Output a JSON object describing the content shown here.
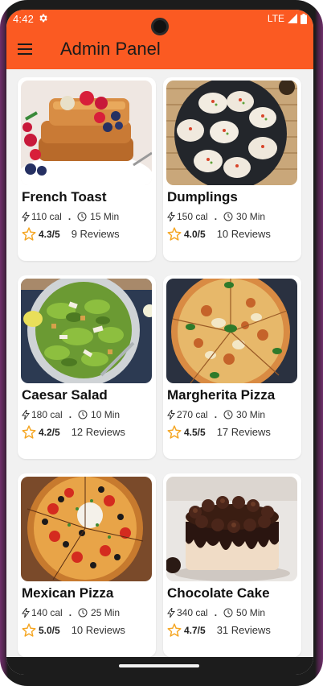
{
  "status_bar": {
    "time": "4:42",
    "network": "LTE"
  },
  "app_bar": {
    "title": "Admin Panel"
  },
  "colors": {
    "accent": "#fb5a22",
    "star": "#f5a623"
  },
  "recipes": [
    {
      "name": "French Toast",
      "calories": "110 cal",
      "time": "15 Min",
      "rating": "4.3/5",
      "reviews": "9 Reviews",
      "image": "french-toast-photo"
    },
    {
      "name": "Dumplings",
      "calories": "150 cal",
      "time": "30 Min",
      "rating": "4.0/5",
      "reviews": "10 Reviews",
      "image": "dumplings-photo"
    },
    {
      "name": "Caesar Salad",
      "calories": "180 cal",
      "time": "10 Min",
      "rating": "4.2/5",
      "reviews": "12 Reviews",
      "image": "caesar-salad-photo"
    },
    {
      "name": "Margherita Pizza",
      "calories": "270 cal",
      "time": "30 Min",
      "rating": "4.5/5",
      "reviews": "17 Reviews",
      "image": "margherita-pizza-photo"
    },
    {
      "name": "Mexican Pizza",
      "calories": "140 cal",
      "time": "25 Min",
      "rating": "5.0/5",
      "reviews": "10 Reviews",
      "image": "mexican-pizza-photo"
    },
    {
      "name": "Chocolate Cake",
      "calories": "340 cal",
      "time": "50 Min",
      "rating": "4.7/5",
      "reviews": "31 Reviews",
      "image": "chocolate-cake-photo"
    }
  ],
  "meta_separator": "."
}
